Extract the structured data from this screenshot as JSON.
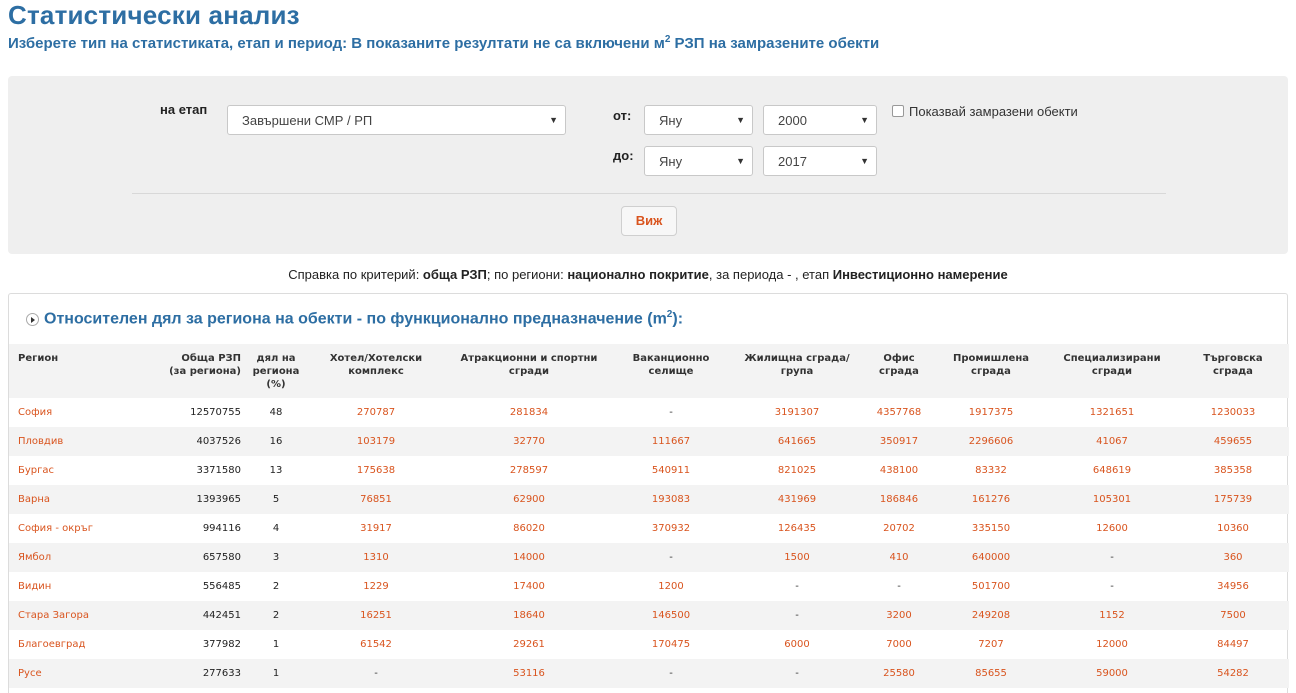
{
  "header": {
    "title": "Статистически анализ",
    "subtitle_pre": "Изберете тип на статистиката, етап и период: В показаните резултати не са включени м",
    "subtitle_sup": "2",
    "subtitle_post": " РЗП на замразените обекти"
  },
  "filters": {
    "stage_label": "на етап",
    "stage_value": "Завършени СМР / РП",
    "from_label": "от:",
    "to_label": "до:",
    "from_month": "Яну",
    "from_year": "2000",
    "to_month": "Яну",
    "to_year": "2017",
    "frozen_checkbox_label": "Показвай замразени обекти",
    "frozen_checked": false,
    "view_button": "Виж"
  },
  "summary": {
    "prefix": "Справка по критерий: ",
    "criterion": "обща РЗП",
    "regions_text": "; по региони: ",
    "coverage": "национално покритие",
    "period_text": ", за периода - , етап ",
    "stage": "Инвестиционно намерение"
  },
  "section": {
    "title_pre": "Относителен дял за региона на обекти - по функционално предназначение (m",
    "title_sup": "2",
    "title_post": "):"
  },
  "table": {
    "headers": [
      "Регион",
      "Обща РЗП\n(за региона)",
      "дял на\nрегиона\n(%)",
      "Хотел/Хотелски\nкомплекс",
      "Атракционни и спортни\nсгради",
      "Ваканционно\nселище",
      "Жилищна сграда/\nгрупа",
      "Офис\nсграда",
      "Промишлена\nсграда",
      "Специализирани\nсгради",
      "Търговска\nсграда"
    ],
    "rows": [
      [
        "София",
        "12570755",
        "48",
        "270787",
        "281834",
        "-",
        "3191307",
        "4357768",
        "1917375",
        "1321651",
        "1230033"
      ],
      [
        "Пловдив",
        "4037526",
        "16",
        "103179",
        "32770",
        "111667",
        "641665",
        "350917",
        "2296606",
        "41067",
        "459655"
      ],
      [
        "Бургас",
        "3371580",
        "13",
        "175638",
        "278597",
        "540911",
        "821025",
        "438100",
        "83332",
        "648619",
        "385358"
      ],
      [
        "Варна",
        "1393965",
        "5",
        "76851",
        "62900",
        "193083",
        "431969",
        "186846",
        "161276",
        "105301",
        "175739"
      ],
      [
        "София - окръг",
        "994116",
        "4",
        "31917",
        "86020",
        "370932",
        "126435",
        "20702",
        "335150",
        "12600",
        "10360"
      ],
      [
        "Ямбол",
        "657580",
        "3",
        "1310",
        "14000",
        "-",
        "1500",
        "410",
        "640000",
        "-",
        "360"
      ],
      [
        "Видин",
        "556485",
        "2",
        "1229",
        "17400",
        "1200",
        "-",
        "-",
        "501700",
        "-",
        "34956"
      ],
      [
        "Стара Загора",
        "442451",
        "2",
        "16251",
        "18640",
        "146500",
        "-",
        "3200",
        "249208",
        "1152",
        "7500"
      ],
      [
        "Благоевград",
        "377982",
        "1",
        "61542",
        "29261",
        "170475",
        "6000",
        "7000",
        "7207",
        "12000",
        "84497"
      ],
      [
        "Русе",
        "277633",
        "1",
        "-",
        "53116",
        "-",
        "-",
        "25580",
        "85655",
        "59000",
        "54282"
      ]
    ]
  }
}
